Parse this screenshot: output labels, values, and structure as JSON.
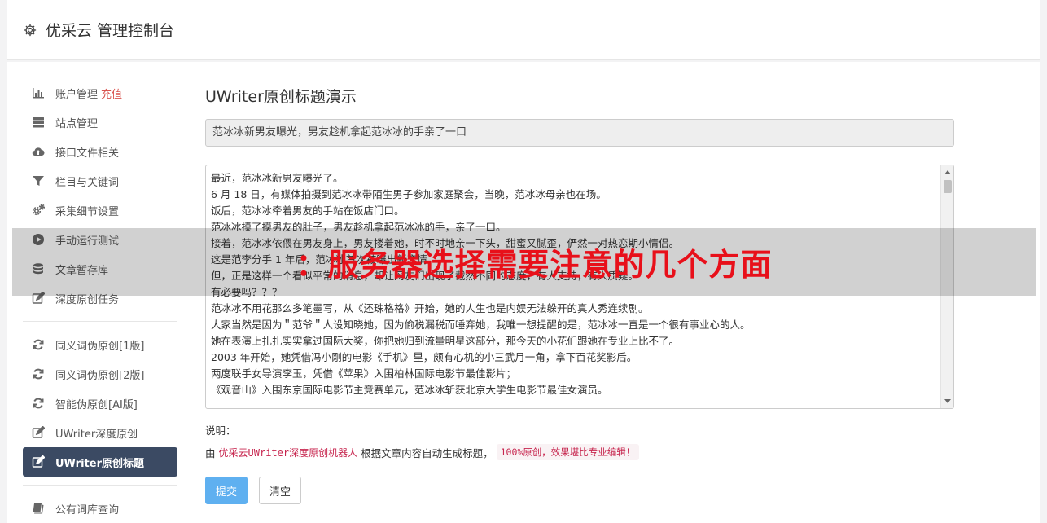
{
  "header": {
    "title": "优采云 管理控制台"
  },
  "sidebar": {
    "items": [
      {
        "label": "账户管理",
        "extra": "充值",
        "icon": "bar-chart-icon"
      },
      {
        "label": "站点管理",
        "icon": "server-icon"
      },
      {
        "label": "接口文件相关",
        "icon": "cloud-upload-icon"
      },
      {
        "label": "栏目与关键词",
        "icon": "filter-icon"
      },
      {
        "label": "采集细节设置",
        "icon": "gears-icon"
      },
      {
        "label": "手动运行测试",
        "icon": "play-circle-icon"
      },
      {
        "label": "文章暂存库",
        "icon": "database-icon"
      },
      {
        "label": "深度原创任务",
        "icon": "edit-icon"
      }
    ],
    "items2": [
      {
        "label": "同义词伪原创[1版]",
        "icon": "refresh-icon"
      },
      {
        "label": "同义词伪原创[2版]",
        "icon": "refresh-icon"
      },
      {
        "label": "智能伪原创[AI版]",
        "icon": "refresh-icon"
      },
      {
        "label": "UWriter深度原创",
        "icon": "edit-icon"
      },
      {
        "label": "UWriter原创标题",
        "icon": "edit-icon",
        "active": true
      }
    ],
    "items3": [
      {
        "label": "公有词库查询",
        "icon": "book-icon"
      }
    ]
  },
  "main": {
    "heading": "UWriter原创标题演示",
    "title_value": "范冰冰新男友曝光，男友趁机拿起范冰冰的手亲了一口",
    "content_lines": [
      "最近，范冰冰新男友曝光了。",
      "6 月 18 日，有媒体拍摄到范冰冰带陌生男子参加家庭聚会，当晚，范冰冰母亲也在场。",
      "饭后，范冰冰牵着男友的手站在饭店门口。",
      "范冰冰摸了摸男友的肚子，男友趁机拿起范冰冰的手，亲了一口。",
      "接着，范冰冰依偎在男友身上，男友搂着她，时不时地亲一下头，甜蜜又腻歪，俨然一对热恋期小情侣。",
      "这是范李分手 1 年后，范冰冰首次被曝出新恋情。",
      "但，正是这样一个看似平常的消息，却让网友们出现了截然不同的态度，有人支持，有人质疑。",
      "有必要吗？？？",
      "范冰冰不用花那么多笔墨写，从《还珠格格》开始，她的人生也是内娱无法躲开的真人秀连续剧。",
      "大家当然是因为＂范爷＂人设知晓她，因为偷税漏税而唾弃她，我唯一想提醒的是，范冰冰一直是一个很有事业心的人。",
      "她在表演上扎扎实实拿过国际大奖，你把她归到流量明星这部分，那今天的小花们跟她在专业上比不了。",
      "2003 年开始，她凭借冯小刚的电影《手机》里，颇有心机的小三武月一角，拿下百花奖影后。",
      "两度联手女导演李玉，凭借《苹果》入围柏林国际电影节最佳影片；",
      "《观音山》入围东京国际电影节主竞赛单元，范冰冰斩获北京大学生电影节最佳女演员。"
    ],
    "note_label": "说明：",
    "note_prefix": "由",
    "note_link": "优采云UWriter深度原创机器人",
    "note_middle": "根据文章内容自动生成标题，",
    "note_code": "100%原创，效果堪比专业编辑！",
    "submit_label": "提交",
    "clear_label": "清空"
  },
  "overlay": {
    "banner_text": "：服务器选择需要注意的几个方面"
  }
}
